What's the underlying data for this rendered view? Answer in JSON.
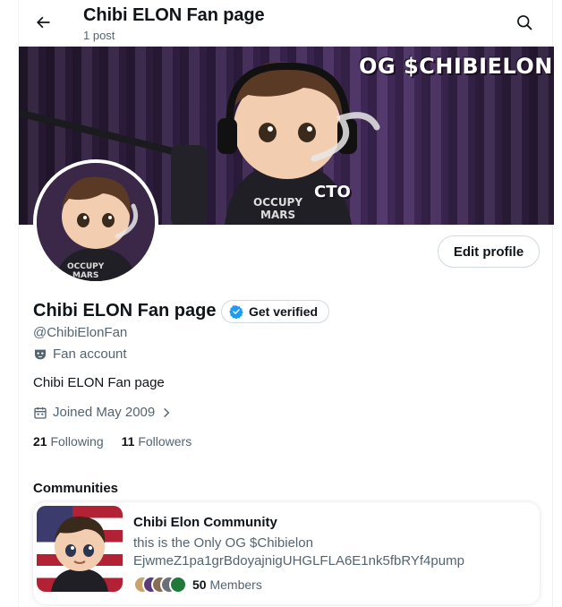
{
  "header": {
    "title": "Chibi ELON Fan page",
    "subtitle": "1 post",
    "back_icon": "arrow-left-icon",
    "search_icon": "search-icon"
  },
  "banner": {
    "headline": "OG $CHIBIELON",
    "tag": "CTO"
  },
  "profile": {
    "edit_label": "Edit profile",
    "name": "Chibi ELON Fan page",
    "verify_label": "Get verified",
    "handle": "@ChibiElonFan",
    "account_type": "Fan account",
    "bio": "Chibi ELON Fan page",
    "joined": "Joined May 2009",
    "following_count": "21",
    "following_label": "Following",
    "followers_count": "11",
    "followers_label": "Followers"
  },
  "communities": {
    "heading": "Communities",
    "items": [
      {
        "name": "Chibi Elon Community",
        "description": "this is the Only OG $Chibielon EjwmeZ1pa1grBdoyajnigUHGLFLA6E1nk5fbRYf4pump",
        "member_count": "50",
        "member_label": "Members"
      }
    ]
  },
  "colors": {
    "accent": "#1d9bf0",
    "text_primary": "#0f1419",
    "text_secondary": "#536471",
    "border": "#cfd9de"
  }
}
